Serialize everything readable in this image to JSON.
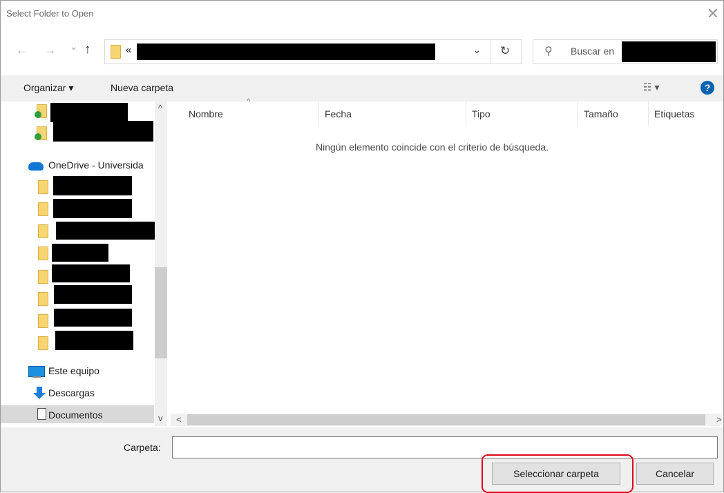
{
  "window": {
    "title": "Select Folder to Open",
    "close_glyph": "✕"
  },
  "nav": {
    "back_glyph": "←",
    "forward_glyph": "→",
    "history_glyph": "⌄",
    "up_glyph": "↑",
    "address_prefix": "«",
    "address_dropdown_glyph": "⌄",
    "refresh_glyph": "↻",
    "search_glyph": "⚲",
    "search_placeholder": "Buscar en"
  },
  "toolbar": {
    "organize_label": "Organizar ▾",
    "new_folder_label": "Nueva carpeta",
    "view_glyph": "☷ ▾",
    "help_glyph": "?"
  },
  "sidebar": {
    "onedrive_label": "OneDrive - Universida",
    "this_pc_label": "Este equipo",
    "downloads_label": "Descargas",
    "documents_label": "Documentos",
    "scroll_up_glyph": "^",
    "scroll_down_glyph": "v"
  },
  "columns": [
    "Nombre",
    "Fecha",
    "Tipo",
    "Tamaño",
    "Etiquetas"
  ],
  "sort_caret": "^",
  "empty_message": "Ningún elemento coincide con el criterio de búsqueda.",
  "hscroll": {
    "left_glyph": "<",
    "right_glyph": ">"
  },
  "footer": {
    "folder_label": "Carpeta:",
    "folder_value": "",
    "select_button": "Seleccionar carpeta",
    "cancel_button": "Cancelar"
  },
  "colors": {
    "accent": "#0063b1",
    "highlight": "#e3051b"
  }
}
